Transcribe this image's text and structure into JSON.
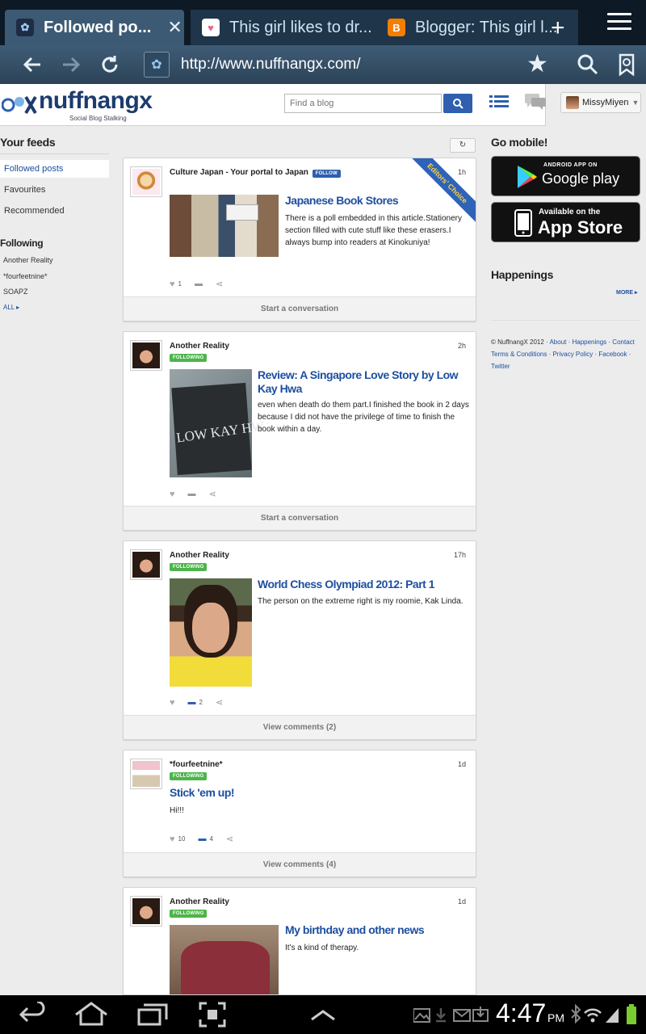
{
  "browser": {
    "tabs": [
      {
        "title": "Followed po...",
        "active": true
      },
      {
        "title": "This girl likes to dr...",
        "active": false
      },
      {
        "title": "Blogger: This girl l...",
        "active": false
      }
    ],
    "new_tab": "+",
    "close_tab": "✕",
    "url": "http://www.nuffnangx.com/"
  },
  "site": {
    "logo_text": "nuffnangx",
    "logo_tagline": "Social Blog Stalking",
    "search_placeholder": "Find a blog",
    "user_name": "MissyMiyen"
  },
  "sidebar": {
    "feeds_title": "Your feeds",
    "feeds": [
      "Followed posts",
      "Favourites",
      "Recommended"
    ],
    "following_title": "Following",
    "following": [
      "Another Reality",
      "*fourfeetnine*",
      "SOAPZ"
    ],
    "all_link": "ALL"
  },
  "posts": [
    {
      "author": "Culture Japan - Your portal to Japan",
      "badge": "FOLLOW",
      "time": "1h",
      "editors_choice": "Editors' Choice",
      "title": "Japanese Book Stores",
      "excerpt": "There is a poll embedded in this article.Stationery section filled with cute stuff like these erasers.I always bump into readers at Kinokuniya!",
      "likes": "1",
      "comments": "",
      "footer": "Start a conversation"
    },
    {
      "author": "Another Reality",
      "badge": "FOLLOWING",
      "time": "2h",
      "title": "Review: A Singapore Love Story by Low Kay Hwa",
      "excerpt": "even when death do them part.I finished the book in 2 days because I did not have the privilege of time to finish the book within a day.",
      "likes": "",
      "comments": "",
      "footer": "Start a conversation",
      "book_cover_text": "LOW KAY HW"
    },
    {
      "author": "Another Reality",
      "badge": "FOLLOWING",
      "time": "17h",
      "title": "World Chess Olympiad 2012: Part 1",
      "excerpt": "The person on the extreme right is my roomie, Kak Linda.",
      "likes": "",
      "comments": "2",
      "footer": "View comments (2)"
    },
    {
      "author": "*fourfeetnine*",
      "badge": "FOLLOWING",
      "time": "1d",
      "title": "Stick 'em up!",
      "excerpt": "Hi!!!",
      "likes": "10",
      "comments": "4",
      "footer": "View comments (4)"
    },
    {
      "author": "Another Reality",
      "badge": "FOLLOWING",
      "time": "1d",
      "title": "My birthday and other news",
      "excerpt": "It's a kind of therapy."
    }
  ],
  "right": {
    "go_mobile": "Go mobile!",
    "google_small": "ANDROID APP ON",
    "google_big": "Google play",
    "apple_small": "Available on the",
    "apple_big": "App Store",
    "happenings": "Happenings",
    "more": "MORE",
    "copyright": "© NuffnangX 2012 ·",
    "links": [
      "About",
      "Happenings",
      "Contact",
      "Terms & Conditions",
      "Privacy Policy",
      "Facebook",
      "Twitter"
    ]
  },
  "system": {
    "time": "4:47",
    "ampm": "PM"
  },
  "colors": {
    "accent": "#1d4fa0",
    "following_badge": "#4cb54a",
    "follow_badge": "#2f5fae",
    "chrome": "#2c4357"
  }
}
